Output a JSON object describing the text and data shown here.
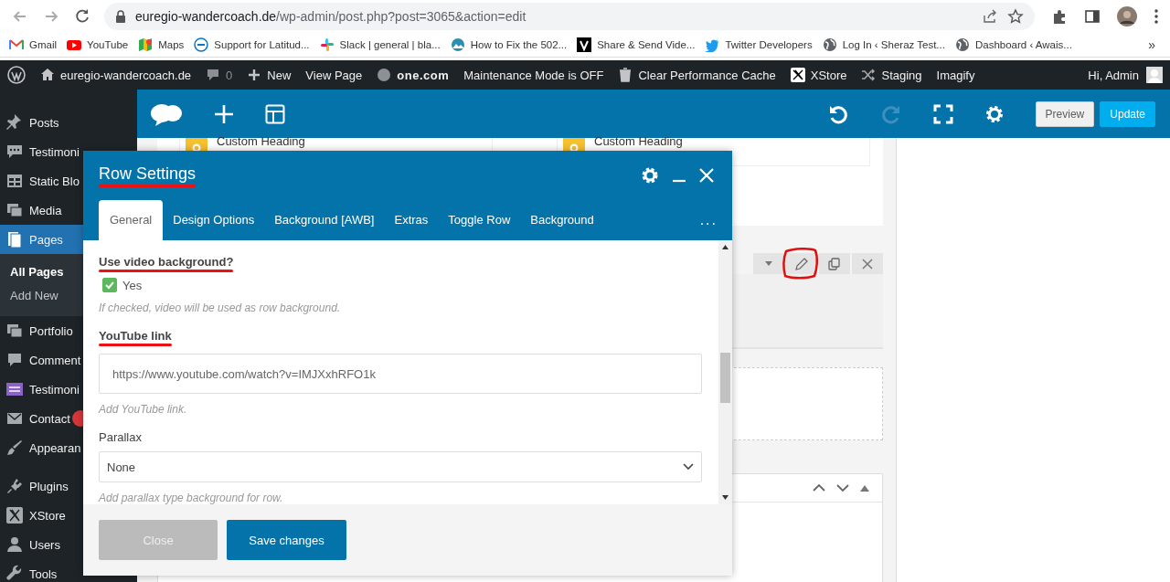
{
  "browser": {
    "address": {
      "domain": "euregio-wandercoach.de",
      "path": "/wp-admin/post.php?post=3065&action=edit"
    },
    "bookmarks": [
      {
        "label": "Gmail",
        "kind": "mail"
      },
      {
        "label": "YouTube",
        "kind": "video"
      },
      {
        "label": "Maps",
        "kind": "map"
      },
      {
        "label": "Support for Latitud...",
        "kind": "support"
      },
      {
        "label": "Slack | general | bla...",
        "kind": "slack"
      },
      {
        "label": "How to Fix the 502...",
        "kind": "site"
      },
      {
        "label": "Share & Send Vide...",
        "kind": "letter"
      },
      {
        "label": "Twitter Developers",
        "kind": "bird"
      },
      {
        "label": "Log In ‹ Sheraz Test...",
        "kind": "globe"
      },
      {
        "label": "Dashboard ‹ Awais...",
        "kind": "globe"
      }
    ],
    "more": "»"
  },
  "admin_bar": {
    "items": [
      {
        "label": "euregio-wandercoach.de",
        "kind": "home"
      },
      {
        "label": "0",
        "kind": "comment"
      },
      {
        "label": "New",
        "kind": "plus"
      },
      {
        "label": "View Page",
        "kind": "none"
      },
      {
        "label": "one.com",
        "kind": "dot"
      },
      {
        "label": "Maintenance Mode is OFF",
        "kind": "none"
      },
      {
        "label": "Clear Performance Cache",
        "kind": "trash"
      },
      {
        "label": "XStore",
        "kind": "xstore"
      },
      {
        "label": "Staging",
        "kind": "shuffle"
      },
      {
        "label": "Imagify",
        "kind": "none"
      }
    ],
    "greeting": "Hi, Admin"
  },
  "sidebar": {
    "items": [
      {
        "label": "Posts",
        "kind": "pin",
        "selected": false
      },
      {
        "label": "Testimoni",
        "kind": "bubble",
        "selected": false
      },
      {
        "label": "Static Blo",
        "kind": "grid",
        "selected": false
      },
      {
        "label": "Media",
        "kind": "media",
        "selected": false
      },
      {
        "label": "Pages",
        "kind": "pages",
        "selected": true,
        "children": [
          {
            "label": "All Pages",
            "selected": true
          },
          {
            "label": "Add New",
            "selected": false
          }
        ]
      },
      {
        "label": "Portfolio",
        "kind": "media",
        "selected": false
      },
      {
        "label": "Comment",
        "kind": "comment",
        "selected": false
      },
      {
        "label": "Testimoni",
        "kind": "screen",
        "selected": false
      },
      {
        "label": "Contact",
        "kind": "mail",
        "selected": false,
        "badge": true
      },
      {
        "label": "Appearan",
        "kind": "brush",
        "selected": false
      },
      {
        "label": "Plugins",
        "kind": "plug",
        "selected": false
      },
      {
        "label": "XStore",
        "kind": "xstore",
        "selected": false
      },
      {
        "label": "Users",
        "kind": "user",
        "selected": false
      },
      {
        "label": "Tools",
        "kind": "wrench",
        "selected": false
      }
    ]
  },
  "builder": {
    "toolbar": {
      "buttons": [
        {
          "label": "Preview",
          "kind": "plain"
        },
        {
          "label": "Update",
          "kind": "primary"
        }
      ]
    },
    "elements": [
      {
        "title": "Custom Heading"
      },
      {
        "title": "Custom Heading"
      }
    ]
  },
  "modal": {
    "title": "Row Settings",
    "tabs": [
      {
        "label": "General",
        "selected": true
      },
      {
        "label": "Design Options",
        "selected": false
      },
      {
        "label": "Background [AWB]",
        "selected": false
      },
      {
        "label": "Extras",
        "selected": false
      },
      {
        "label": "Toggle Row",
        "selected": false
      },
      {
        "label": "Background",
        "selected": false
      }
    ],
    "more": "...",
    "fields": [
      {
        "kind": "checkbox",
        "label": "Use video background?",
        "option": "Yes",
        "checked": true,
        "help": "If checked, video will be used as row background."
      },
      {
        "kind": "text",
        "label": "YouTube link",
        "value": "https://www.youtube.com/watch?v=IMJXxhRFO1k",
        "help": "Add YouTube link."
      },
      {
        "kind": "select",
        "label": "Parallax",
        "value": "None",
        "help": "Add parallax type background for row."
      }
    ],
    "buttons": [
      {
        "label": "Close",
        "kind": "secondary"
      },
      {
        "label": "Save changes",
        "kind": "primary"
      }
    ]
  }
}
